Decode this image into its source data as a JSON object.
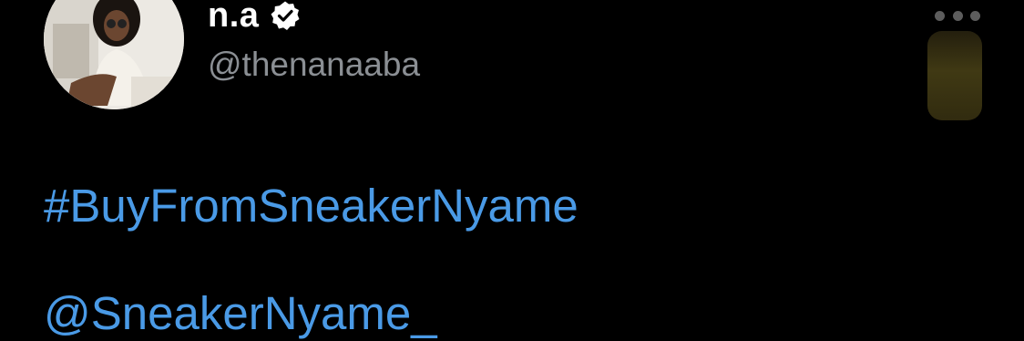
{
  "user": {
    "display_name": "n.a",
    "handle": "@thenanaaba",
    "verified": true,
    "avatar_icon": "profile-photo"
  },
  "tweet": {
    "hashtag": "#BuyFromSneakerNyame",
    "mention": "@SneakerNyame_"
  },
  "controls": {
    "more_icon": "ellipsis-horizontal-icon"
  },
  "colors": {
    "background": "#000000",
    "link": "#4a9ae6",
    "handle": "#8b8f94",
    "name": "#ffffff"
  }
}
